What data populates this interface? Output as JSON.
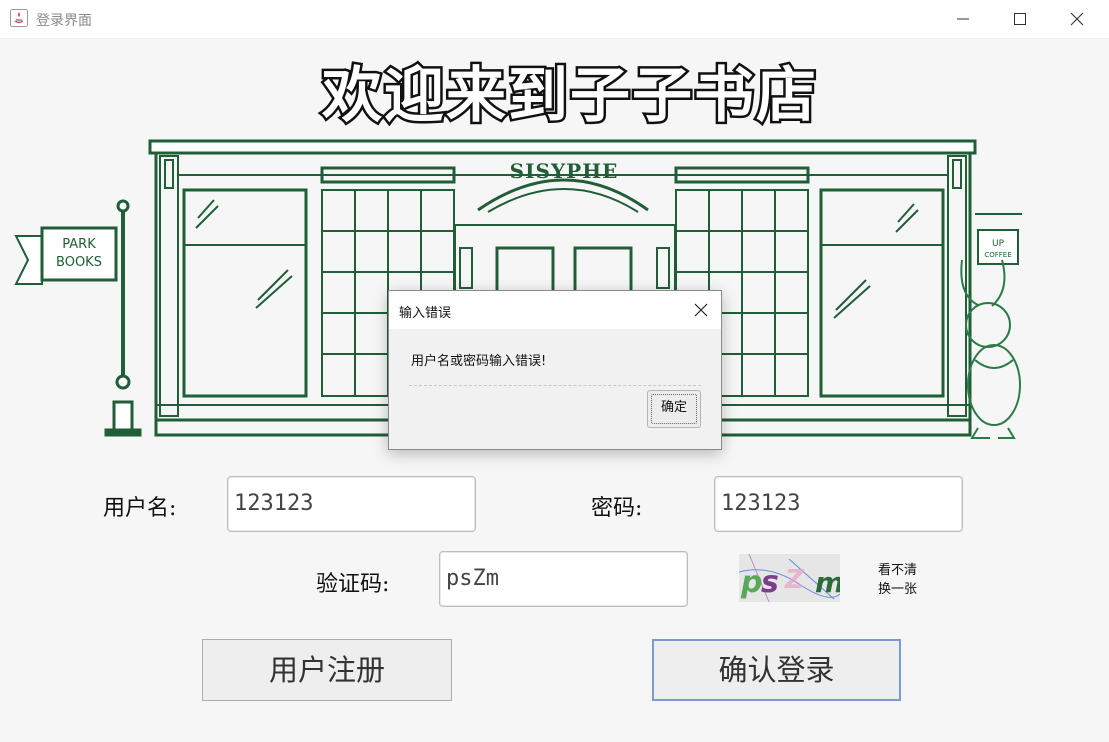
{
  "window": {
    "title": "登录界面"
  },
  "banner": {
    "title": "欢迎来到子子书店",
    "sign": "SISYPHE",
    "flag_line1": "PARK",
    "flag_line2": "BOOKS",
    "cup_line1": "UP",
    "cup_line2": "COFFEE"
  },
  "form": {
    "username_label": "用户名:",
    "username_value": "123123",
    "password_label": "密码:",
    "password_value": "123123",
    "captcha_label": "验证码:",
    "captcha_value": "psZm",
    "captcha_image_text": "psZm",
    "refresh_line1": "看不清",
    "refresh_line2": "换一张",
    "register_button": "用户注册",
    "login_button": "确认登录"
  },
  "dialog": {
    "title": "输入错误",
    "message": "用户名或密码输入错误!",
    "ok_button": "确定"
  },
  "colors": {
    "store_green": "#1f5e37",
    "window_bg": "#f6f6f6",
    "focus_border": "#7a9ad0"
  }
}
